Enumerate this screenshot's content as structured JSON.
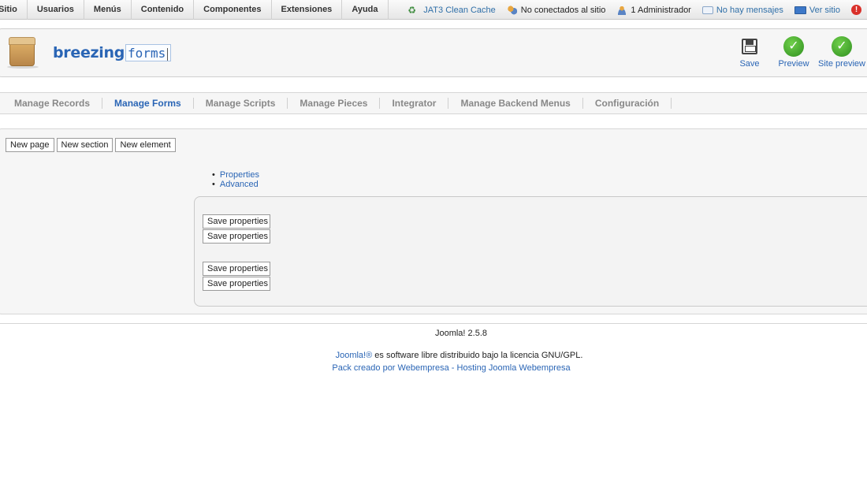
{
  "topmenu": {
    "items": [
      "Sitio",
      "Usuarios",
      "Menús",
      "Contenido",
      "Componentes",
      "Extensiones",
      "Ayuda"
    ]
  },
  "status": {
    "cache": "JAT3 Clean Cache",
    "visitors": "No conectados al sitio",
    "admins": "1 Administrador",
    "messages": "No hay mensajes",
    "view_site": "Ver sitio",
    "logout_icon": "!"
  },
  "header": {
    "logo_bold": "breezing",
    "logo_light": "forms",
    "toolbar": {
      "save": "Save",
      "preview": "Preview",
      "site_preview": "Site preview"
    }
  },
  "tabs": [
    {
      "label": "Manage Records",
      "active": false
    },
    {
      "label": "Manage Forms",
      "active": true
    },
    {
      "label": "Manage Scripts",
      "active": false
    },
    {
      "label": "Manage Pieces",
      "active": false
    },
    {
      "label": "Integrator",
      "active": false
    },
    {
      "label": "Manage Backend Menus",
      "active": false
    },
    {
      "label": "Configuración",
      "active": false
    }
  ],
  "main": {
    "new_buttons": [
      "New page",
      "New section",
      "New element"
    ],
    "links": [
      "Properties",
      "Advanced"
    ],
    "save_properties_label": "Save properties"
  },
  "footer": {
    "version": "Joomla! 2.5.8",
    "joomla_link": "Joomla!®",
    "license_text": " es software libre distribuido bajo la licencia GNU/GPL.",
    "credit": "Pack creado por Webempresa - Hosting Joomla Webempresa"
  },
  "colors": {
    "link": "#2a65b5",
    "active_tab": "#2a65b5",
    "inactive_tab": "#888888",
    "preview_green": "#2f8f1f"
  }
}
